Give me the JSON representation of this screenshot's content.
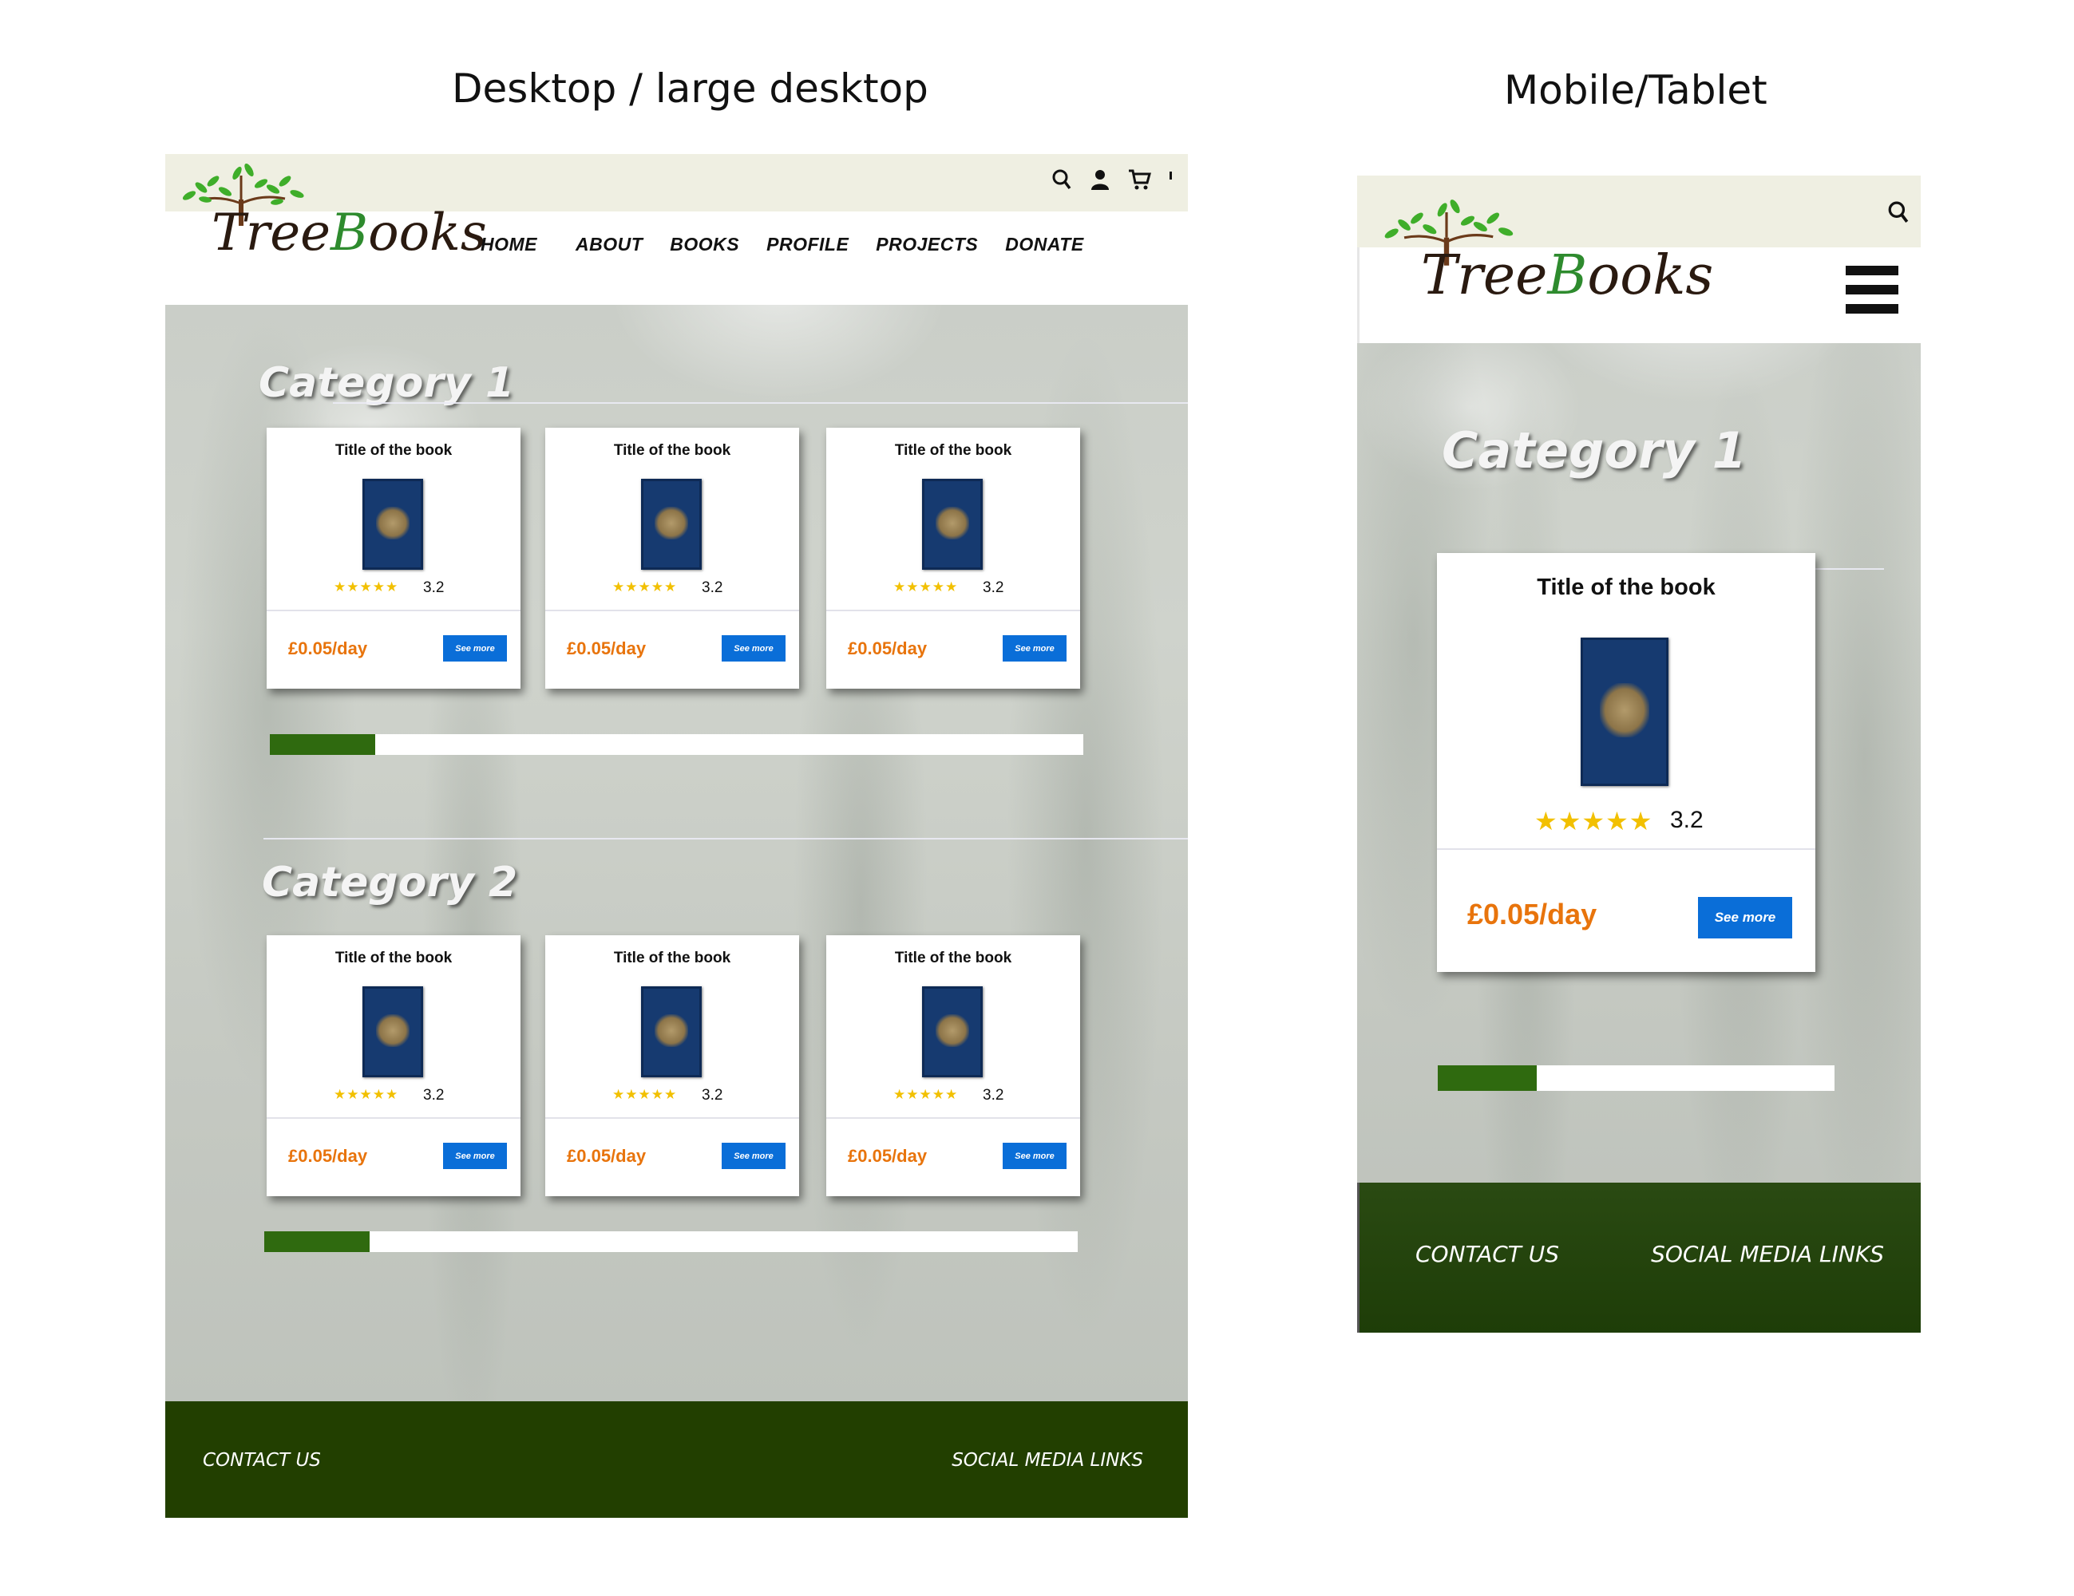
{
  "headings": {
    "desktop": "Desktop / large desktop",
    "mobile": "Mobile/Tablet"
  },
  "brand": {
    "logo_text_prefix": "Tree",
    "logo_text_accent": "B",
    "logo_text_suffix": "ooks"
  },
  "desktop": {
    "header_icons": [
      "search-icon",
      "user-icon",
      "cart-icon"
    ],
    "nav": [
      "HOME",
      "ABOUT",
      "BOOKS",
      "PROFILE",
      "PROJECTS",
      "DONATE"
    ],
    "categories": [
      {
        "title": "Category 1",
        "progress": 0.13,
        "books": [
          {
            "title": "Title of the book",
            "stars": "★★★★★",
            "rating": "3.2",
            "price": "£0.05/day",
            "button": "See more"
          },
          {
            "title": "Title of the book",
            "stars": "★★★★★",
            "rating": "3.2",
            "price": "£0.05/day",
            "button": "See more"
          },
          {
            "title": "Title of the book",
            "stars": "★★★★★",
            "rating": "3.2",
            "price": "£0.05/day",
            "button": "See more"
          }
        ]
      },
      {
        "title": "Category 2",
        "progress": 0.13,
        "books": [
          {
            "title": "Title of the book",
            "stars": "★★★★★",
            "rating": "3.2",
            "price": "£0.05/day",
            "button": "See more"
          },
          {
            "title": "Title of the book",
            "stars": "★★★★★",
            "rating": "3.2",
            "price": "£0.05/day",
            "button": "See more"
          },
          {
            "title": "Title of the book",
            "stars": "★★★★★",
            "rating": "3.2",
            "price": "£0.05/day",
            "button": "See more"
          }
        ]
      }
    ],
    "footer": {
      "contact": "CONTACT US",
      "social": "SOCIAL MEDIA LINKS"
    }
  },
  "mobile": {
    "header_icons": [
      "search-icon",
      "hamburger-menu-icon"
    ],
    "category": {
      "title": "Category 1",
      "progress": 0.25,
      "book": {
        "title": "Title of the book",
        "stars": "★★★★★",
        "rating": "3.2",
        "price": "£0.05/day",
        "button": "See more"
      }
    },
    "footer": {
      "contact": "CONTACT US",
      "social": "SOCIAL MEDIA LINKS"
    }
  },
  "colors": {
    "topbar": "#efefe2",
    "footer": "#223f00",
    "progress_fill": "#2f6a0f",
    "price": "#e8740c",
    "button": "#0a6ed8",
    "stars": "#f2c000",
    "book_cover": "#163a70"
  }
}
